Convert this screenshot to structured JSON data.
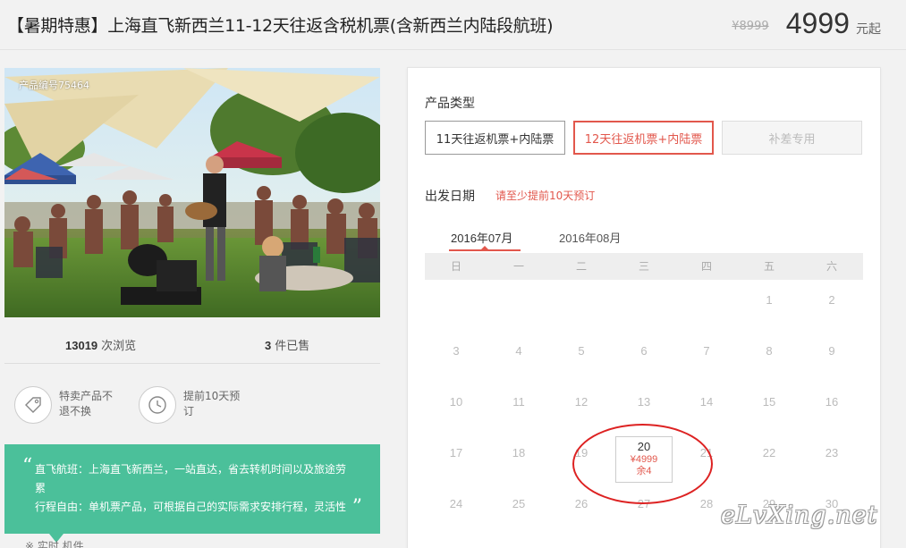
{
  "header": {
    "title": "【暑期特惠】上海直飞新西兰11-12天往返含税机票(含新西兰内陆段航班)",
    "old_price": "¥8999",
    "price": "4999",
    "price_unit": "元起"
  },
  "product": {
    "code_label": "产品编号75464",
    "views_count": "13019",
    "views_label": "次浏览",
    "sold_count": "3",
    "sold_label": "件已售"
  },
  "features": [
    {
      "icon": "tag-icon",
      "text": "特卖产品不退不换"
    },
    {
      "icon": "clock-icon",
      "text": "提前10天预订"
    }
  ],
  "highlight": {
    "line1": "直飞航班：上海直飞新西兰，一站直达，省去转机时间以及旅途劳累",
    "line2": "行程自由：单机票产品，可根据自己的实际需求安排行程，灵活性",
    "open_quote": "“",
    "close_quote": "”"
  },
  "bottom_fragment": "※ 实时 机件",
  "booking": {
    "type_label": "产品类型",
    "types": [
      "11天往返机票+内陆票",
      "12天往返机票+内陆票",
      "补差专用"
    ],
    "selected_type": 1,
    "date_label": "出发日期",
    "date_tip": "请至少提前10天预订",
    "months": [
      "2016年07月",
      "2016年08月"
    ],
    "active_month": 0,
    "weekdays": [
      "日",
      "一",
      "二",
      "三",
      "四",
      "五",
      "六"
    ],
    "days": [
      "",
      "",
      "",
      "",
      "",
      "1",
      "2",
      "3",
      "4",
      "5",
      "6",
      "7",
      "8",
      "9",
      "10",
      "11",
      "12",
      "13",
      "14",
      "15",
      "16",
      "17",
      "18",
      "19",
      "20",
      "21",
      "22",
      "23",
      "24",
      "25",
      "26",
      "27",
      "28",
      "29",
      "30"
    ],
    "available_day": {
      "day": "20",
      "price": "¥4999",
      "remaining": "余4"
    }
  },
  "watermark": "eLvXing.net",
  "colors": {
    "accent": "#e2574c",
    "highlight_bg": "#4bc09a",
    "annotation": "#dd2222"
  }
}
